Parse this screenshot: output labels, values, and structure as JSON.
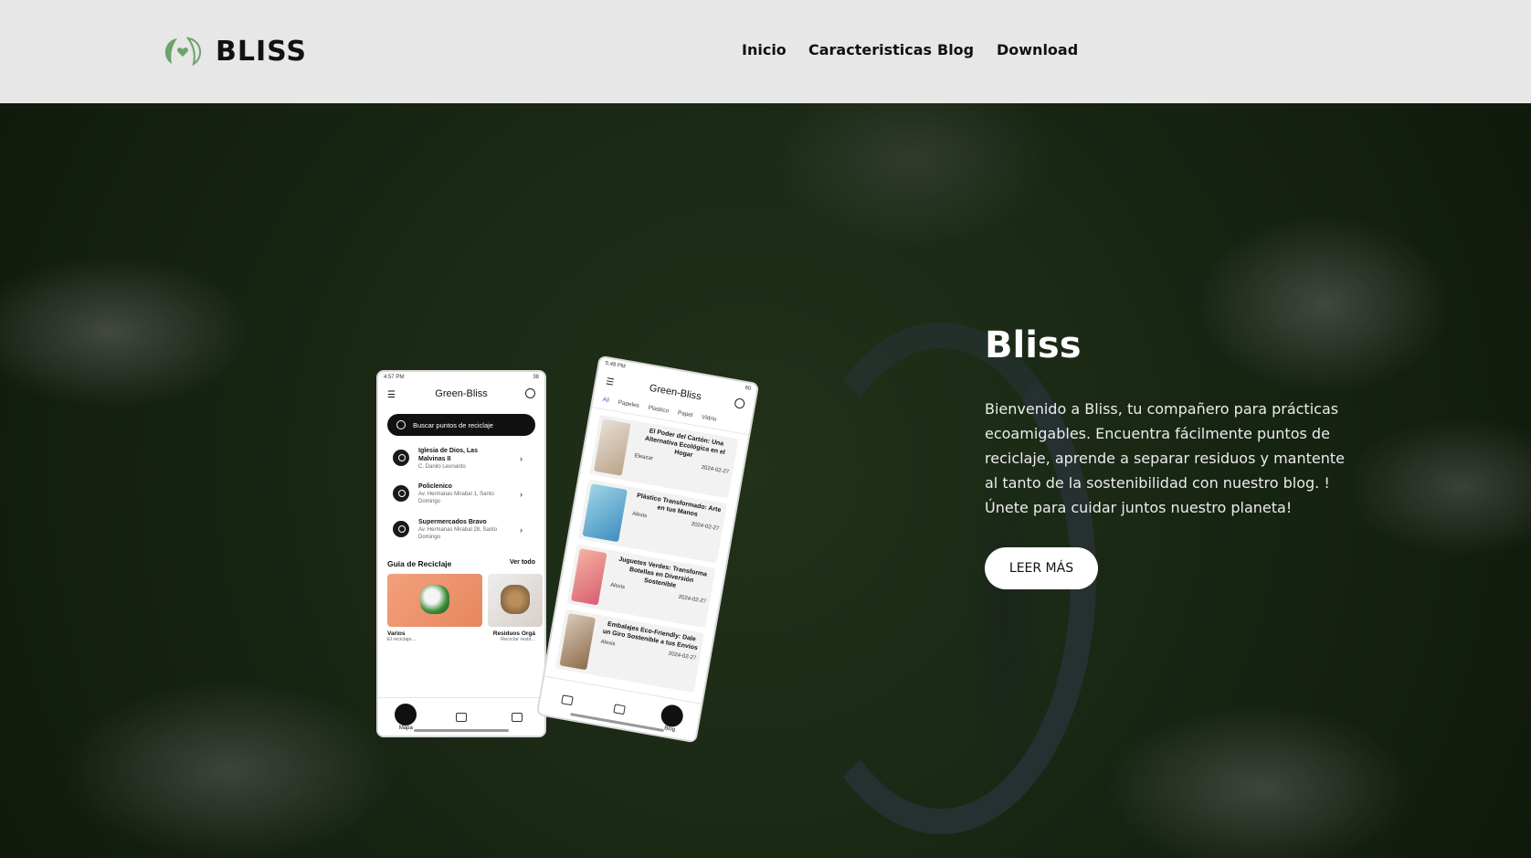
{
  "brand": {
    "name": "BLISS"
  },
  "nav": {
    "items": [
      "Inicio",
      "Caracteristicas",
      "Blog",
      "Download"
    ]
  },
  "hero": {
    "title": "Bliss",
    "description": "Bienvenido a Bliss, tu compañero para prácticas ecoamigables. Encuentra fácilmente puntos de reciclaje, aprende a separar residuos y mantente al tanto de la sostenibilidad con nuestro blog. !Únete para cuidar juntos nuestro planeta!",
    "cta_label": "LEER MÁS"
  },
  "phone_left": {
    "status_time": "4:57 PM",
    "status_right": "38",
    "app_title": "Green-Bliss",
    "search_placeholder": "Buscar puntos de reciclaje",
    "locations": [
      {
        "name": "Iglesia de Dios, Las Malvinas II",
        "address": "C. Danilo Leonardo"
      },
      {
        "name": "Policlenico",
        "address": "Av. Hermanas Mirabal 1, Santo Domingo"
      },
      {
        "name": "Supermercados Bravo",
        "address": "Av. Hermanas Mirabal 28, Santo Domingo"
      }
    ],
    "guide_title": "Guia de Reciclaje",
    "guide_all": "Ver todo",
    "cards": [
      {
        "label": "Varios",
        "sub": "El reciclaje..."
      },
      {
        "label": "Residuos Orgá",
        "sub": "Reciclar resid..."
      }
    ],
    "tabs": [
      "Mapa",
      "",
      ""
    ]
  },
  "phone_right": {
    "status_time": "5:48 PM",
    "status_right": "60",
    "app_title": "Green-Bliss",
    "chips": [
      "All",
      "Papeles",
      "Plastico",
      "Papel",
      "Vidrio"
    ],
    "posts": [
      {
        "title": "El Poder del Cartón: Una Alternativa Ecológica en el Hogar",
        "author": "Eleazar",
        "date": "2024-02-27"
      },
      {
        "title": "Plástico Transformado: Arte en tus Manos",
        "author": "Alexis",
        "date": "2024-02-27"
      },
      {
        "title": "Juguetes Verdes: Transforma Botellas en Diversión Sostenible",
        "author": "Alexis",
        "date": "2024-02-27"
      },
      {
        "title": "Embalajes Eco-Friendly: Dale un Giro Sostenible a tus Envíos",
        "author": "Alexis",
        "date": "2024-02-27"
      }
    ],
    "tabs": [
      "",
      "",
      "Blog"
    ]
  },
  "colors": {
    "header_bg": "#e7e7e7",
    "logo_green": "#6aa469",
    "cta_bg": "#ffffff"
  }
}
